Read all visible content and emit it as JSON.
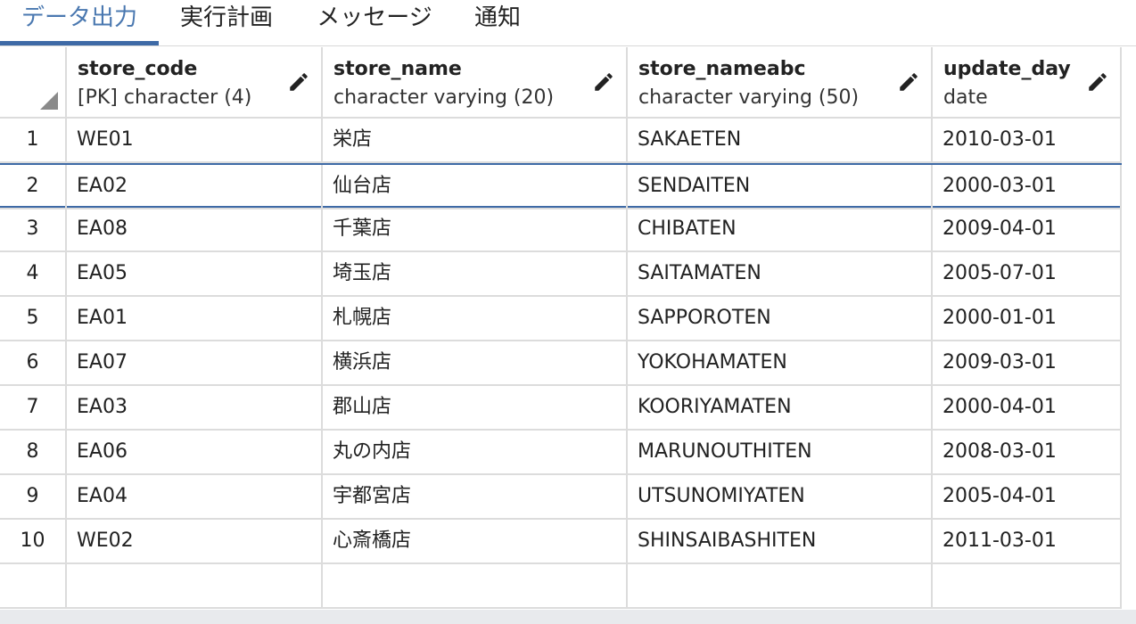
{
  "tabs": [
    {
      "label": "データ出力",
      "active": true
    },
    {
      "label": "実行計画",
      "active": false
    },
    {
      "label": "メッセージ",
      "active": false
    },
    {
      "label": "通知",
      "active": false
    }
  ],
  "columns": [
    {
      "name": "store_code",
      "type": "[PK] character (4)"
    },
    {
      "name": "store_name",
      "type": "character varying (20)"
    },
    {
      "name": "store_nameabc",
      "type": "character varying (50)"
    },
    {
      "name": "update_day",
      "type": "date"
    }
  ],
  "rows": [
    {
      "num": "1",
      "cells": [
        "WE01",
        "栄店",
        "SAKAETEN",
        "2010-03-01"
      ]
    },
    {
      "num": "2",
      "cells": [
        "EA02",
        "仙台店",
        "SENDAITEN",
        "2000-03-01"
      ]
    },
    {
      "num": "3",
      "cells": [
        "EA08",
        "千葉店",
        "CHIBATEN",
        "2009-04-01"
      ]
    },
    {
      "num": "4",
      "cells": [
        "EA05",
        "埼玉店",
        "SAITAMATEN",
        "2005-07-01"
      ]
    },
    {
      "num": "5",
      "cells": [
        "EA01",
        "札幌店",
        "SAPPOROTEN",
        "2000-01-01"
      ]
    },
    {
      "num": "6",
      "cells": [
        "EA07",
        "横浜店",
        "YOKOHAMATEN",
        "2009-03-01"
      ]
    },
    {
      "num": "7",
      "cells": [
        "EA03",
        "郡山店",
        "KOORIYAMATEN",
        "2000-04-01"
      ]
    },
    {
      "num": "8",
      "cells": [
        "EA06",
        "丸の内店",
        "MARUNOUTHITEN",
        "2008-03-01"
      ]
    },
    {
      "num": "9",
      "cells": [
        "EA04",
        "宇都宮店",
        "UTSUNOMIYATEN",
        "2005-04-01"
      ]
    },
    {
      "num": "10",
      "cells": [
        "WE02",
        "心斎橋店",
        "SHINSAIBASHITEN",
        "2011-03-01"
      ]
    }
  ],
  "selected_row": 1,
  "colors": {
    "accent": "#3e6aa6",
    "active_tab": "#4a78b0",
    "gridline": "#dcdcdc"
  }
}
